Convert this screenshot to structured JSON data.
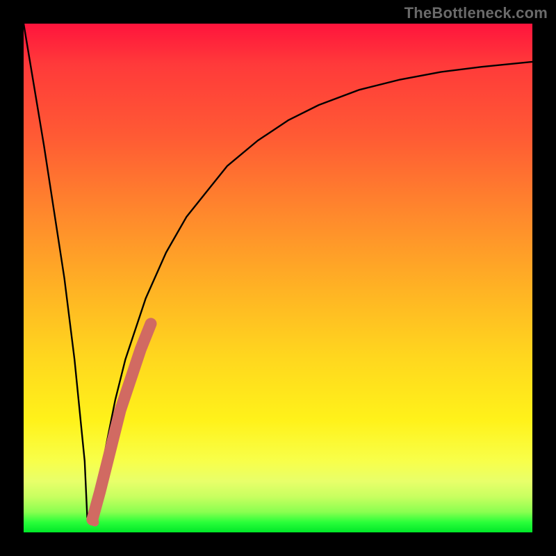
{
  "watermark": "TheBottleneck.com",
  "colors": {
    "curve_stroke": "#000000",
    "highlight_stroke": "#d16a62",
    "highlight_fill": "#d16a62",
    "frame": "#000000"
  },
  "chart_data": {
    "type": "line",
    "title": "",
    "xlabel": "",
    "ylabel": "",
    "xlim": [
      0,
      100
    ],
    "ylim": [
      0,
      100
    ],
    "legend": false,
    "grid": false,
    "series": [
      {
        "name": "bottleneck-curve",
        "x": [
          0,
          2,
          4,
          6,
          8,
          10,
          12,
          12.5,
          13,
          14,
          16,
          18,
          20,
          24,
          28,
          32,
          36,
          40,
          46,
          52,
          58,
          66,
          74,
          82,
          90,
          100
        ],
        "values": [
          100,
          88,
          76,
          63,
          50,
          34,
          14,
          3,
          2,
          6,
          16,
          26,
          34,
          46,
          55,
          62,
          67,
          72,
          77,
          81,
          84,
          87,
          89,
          90.5,
          91.5,
          92.5
        ]
      }
    ],
    "highlight_segment": {
      "description": "thick salmon segment on rising branch near the minimum",
      "x": [
        13.5,
        15,
        17,
        19,
        21,
        23,
        25
      ],
      "values": [
        2.5,
        8,
        16,
        24,
        30,
        36,
        41
      ]
    },
    "highlight_point": {
      "description": "small salmon dot just right of the minimum",
      "x": 14,
      "value": 2
    },
    "background_gradient": {
      "top": "#ff143c",
      "upper_mid": "#ff8a2c",
      "mid": "#ffd81e",
      "lower_mid": "#f8ff4a",
      "bottom": "#00e828"
    }
  }
}
